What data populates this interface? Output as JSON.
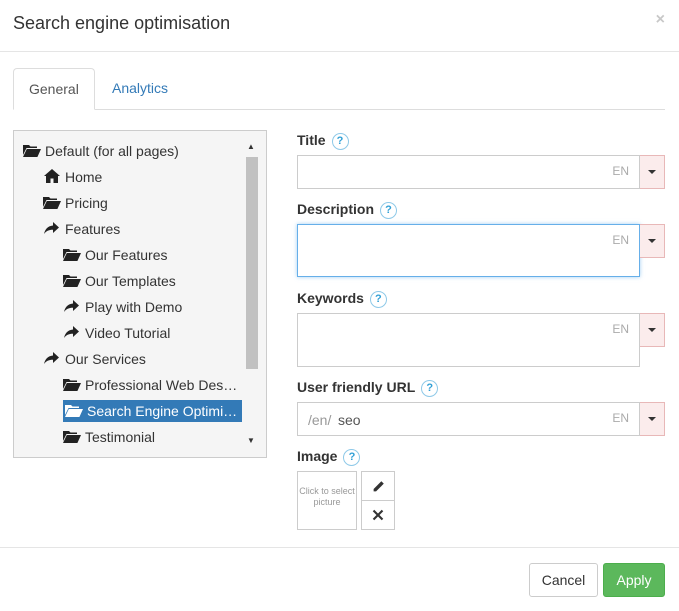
{
  "dialog": {
    "title": "Search engine optimisation",
    "close_glyph": "×"
  },
  "tabs": [
    {
      "label": "General",
      "active": true
    },
    {
      "label": "Analytics",
      "active": false
    }
  ],
  "tree": {
    "items": [
      {
        "label": "Default (for all pages)",
        "icon": "folder-open-icon",
        "depth": 0
      },
      {
        "label": "Home",
        "icon": "home-icon",
        "depth": 1
      },
      {
        "label": "Pricing",
        "icon": "folder-open-icon",
        "depth": 1
      },
      {
        "label": "Features",
        "icon": "share-arrow-icon",
        "depth": 1
      },
      {
        "label": "Our Features",
        "icon": "folder-open-icon",
        "depth": 2
      },
      {
        "label": "Our Templates",
        "icon": "folder-open-icon",
        "depth": 2
      },
      {
        "label": "Play with Demo",
        "icon": "share-arrow-icon",
        "depth": 2
      },
      {
        "label": "Video Tutorial",
        "icon": "share-arrow-icon",
        "depth": 2
      },
      {
        "label": "Our Services",
        "icon": "share-arrow-icon",
        "depth": 1
      },
      {
        "label": "Professional Web Des…",
        "icon": "folder-open-icon",
        "depth": 2
      },
      {
        "label": "Search Engine Optimi…",
        "icon": "folder-open-icon",
        "depth": 2,
        "selected": true
      },
      {
        "label": "Testimonial",
        "icon": "folder-open-icon",
        "depth": 2
      }
    ]
  },
  "form": {
    "help_glyph": "?",
    "title": {
      "label": "Title",
      "value": "",
      "lang": "EN"
    },
    "description": {
      "label": "Description",
      "value": "",
      "lang": "EN"
    },
    "keywords": {
      "label": "Keywords",
      "value": "",
      "lang": "EN"
    },
    "url": {
      "label": "User friendly URL",
      "prefix": "/en/",
      "value": "seo",
      "lang": "EN"
    },
    "image": {
      "label": "Image",
      "placeholder": "Click to select picture"
    }
  },
  "footer": {
    "cancel_label": "Cancel",
    "apply_label": "Apply"
  },
  "colors": {
    "primary": "#337ab7",
    "success": "#5cb85c",
    "danger_bg": "#fbecec",
    "help": "#31a0d6"
  }
}
